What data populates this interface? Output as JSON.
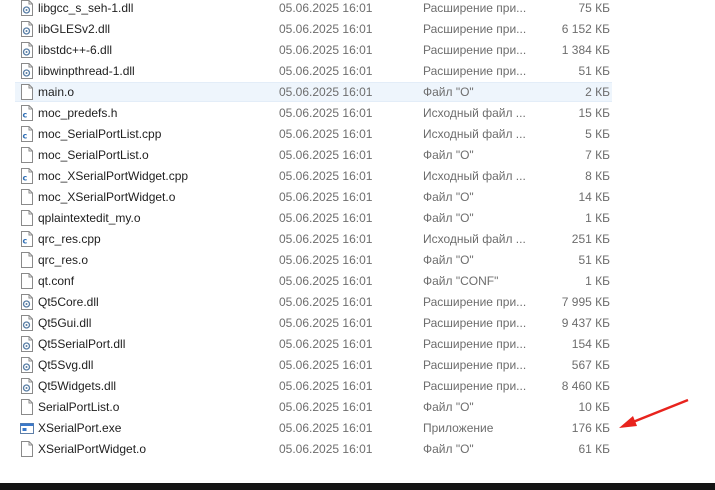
{
  "files": [
    {
      "name": "libgcc_s_seh-1.dll",
      "date": "05.06.2025 16:01",
      "type": "Расширение при...",
      "size": "75 КБ",
      "icon": "dll-icon"
    },
    {
      "name": "libGLESv2.dll",
      "date": "05.06.2025 16:01",
      "type": "Расширение при...",
      "size": "6 152 КБ",
      "icon": "dll-icon"
    },
    {
      "name": "libstdc++-6.dll",
      "date": "05.06.2025 16:01",
      "type": "Расширение при...",
      "size": "1 384 КБ",
      "icon": "dll-icon"
    },
    {
      "name": "libwinpthread-1.dll",
      "date": "05.06.2025 16:01",
      "type": "Расширение при...",
      "size": "51 КБ",
      "icon": "dll-icon"
    },
    {
      "name": "main.o",
      "date": "05.06.2025 16:01",
      "type": "Файл \"O\"",
      "size": "2 КБ",
      "icon": "file-icon",
      "selected": true
    },
    {
      "name": "moc_predefs.h",
      "date": "05.06.2025 16:01",
      "type": "Исходный файл ...",
      "size": "15 КБ",
      "icon": "source-file-icon"
    },
    {
      "name": "moc_SerialPortList.cpp",
      "date": "05.06.2025 16:01",
      "type": "Исходный файл ...",
      "size": "5 КБ",
      "icon": "source-file-icon"
    },
    {
      "name": "moc_SerialPortList.o",
      "date": "05.06.2025 16:01",
      "type": "Файл \"O\"",
      "size": "7 КБ",
      "icon": "file-icon"
    },
    {
      "name": "moc_XSerialPortWidget.cpp",
      "date": "05.06.2025 16:01",
      "type": "Исходный файл ...",
      "size": "8 КБ",
      "icon": "source-file-icon"
    },
    {
      "name": "moc_XSerialPortWidget.o",
      "date": "05.06.2025 16:01",
      "type": "Файл \"O\"",
      "size": "14 КБ",
      "icon": "file-icon"
    },
    {
      "name": "qplaintextedit_my.o",
      "date": "05.06.2025 16:01",
      "type": "Файл \"O\"",
      "size": "1 КБ",
      "icon": "file-icon"
    },
    {
      "name": "qrc_res.cpp",
      "date": "05.06.2025 16:01",
      "type": "Исходный файл ...",
      "size": "251 КБ",
      "icon": "source-file-icon"
    },
    {
      "name": "qrc_res.o",
      "date": "05.06.2025 16:01",
      "type": "Файл \"O\"",
      "size": "51 КБ",
      "icon": "file-icon"
    },
    {
      "name": "qt.conf",
      "date": "05.06.2025 16:01",
      "type": "Файл \"CONF\"",
      "size": "1 КБ",
      "icon": "file-icon"
    },
    {
      "name": "Qt5Core.dll",
      "date": "05.06.2025 16:01",
      "type": "Расширение при...",
      "size": "7 995 КБ",
      "icon": "dll-icon"
    },
    {
      "name": "Qt5Gui.dll",
      "date": "05.06.2025 16:01",
      "type": "Расширение при...",
      "size": "9 437 КБ",
      "icon": "dll-icon"
    },
    {
      "name": "Qt5SerialPort.dll",
      "date": "05.06.2025 16:01",
      "type": "Расширение при...",
      "size": "154 КБ",
      "icon": "dll-icon"
    },
    {
      "name": "Qt5Svg.dll",
      "date": "05.06.2025 16:01",
      "type": "Расширение при...",
      "size": "567 КБ",
      "icon": "dll-icon"
    },
    {
      "name": "Qt5Widgets.dll",
      "date": "05.06.2025 16:01",
      "type": "Расширение при...",
      "size": "8 460 КБ",
      "icon": "dll-icon"
    },
    {
      "name": "SerialPortList.o",
      "date": "05.06.2025 16:01",
      "type": "Файл \"O\"",
      "size": "10 КБ",
      "icon": "file-icon"
    },
    {
      "name": "XSerialPort.exe",
      "date": "05.06.2025 16:01",
      "type": "Приложение",
      "size": "176 КБ",
      "icon": "exe-icon"
    },
    {
      "name": "XSerialPortWidget.o",
      "date": "05.06.2025 16:01",
      "type": "Файл \"O\"",
      "size": "61 КБ",
      "icon": "file-icon"
    }
  ],
  "annotation": {
    "arrow_color": "#e8231d"
  }
}
